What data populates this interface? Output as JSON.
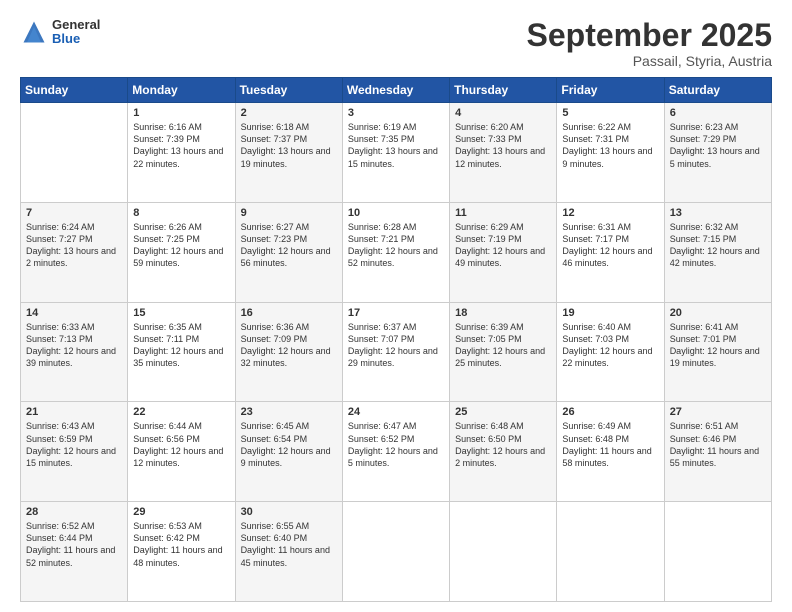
{
  "header": {
    "logo_general": "General",
    "logo_blue": "Blue",
    "month": "September 2025",
    "location": "Passail, Styria, Austria"
  },
  "days_of_week": [
    "Sunday",
    "Monday",
    "Tuesday",
    "Wednesday",
    "Thursday",
    "Friday",
    "Saturday"
  ],
  "weeks": [
    [
      {
        "day": "",
        "sunrise": "",
        "sunset": "",
        "daylight": ""
      },
      {
        "day": "1",
        "sunrise": "Sunrise: 6:16 AM",
        "sunset": "Sunset: 7:39 PM",
        "daylight": "Daylight: 13 hours and 22 minutes."
      },
      {
        "day": "2",
        "sunrise": "Sunrise: 6:18 AM",
        "sunset": "Sunset: 7:37 PM",
        "daylight": "Daylight: 13 hours and 19 minutes."
      },
      {
        "day": "3",
        "sunrise": "Sunrise: 6:19 AM",
        "sunset": "Sunset: 7:35 PM",
        "daylight": "Daylight: 13 hours and 15 minutes."
      },
      {
        "day": "4",
        "sunrise": "Sunrise: 6:20 AM",
        "sunset": "Sunset: 7:33 PM",
        "daylight": "Daylight: 13 hours and 12 minutes."
      },
      {
        "day": "5",
        "sunrise": "Sunrise: 6:22 AM",
        "sunset": "Sunset: 7:31 PM",
        "daylight": "Daylight: 13 hours and 9 minutes."
      },
      {
        "day": "6",
        "sunrise": "Sunrise: 6:23 AM",
        "sunset": "Sunset: 7:29 PM",
        "daylight": "Daylight: 13 hours and 5 minutes."
      }
    ],
    [
      {
        "day": "7",
        "sunrise": "Sunrise: 6:24 AM",
        "sunset": "Sunset: 7:27 PM",
        "daylight": "Daylight: 13 hours and 2 minutes."
      },
      {
        "day": "8",
        "sunrise": "Sunrise: 6:26 AM",
        "sunset": "Sunset: 7:25 PM",
        "daylight": "Daylight: 12 hours and 59 minutes."
      },
      {
        "day": "9",
        "sunrise": "Sunrise: 6:27 AM",
        "sunset": "Sunset: 7:23 PM",
        "daylight": "Daylight: 12 hours and 56 minutes."
      },
      {
        "day": "10",
        "sunrise": "Sunrise: 6:28 AM",
        "sunset": "Sunset: 7:21 PM",
        "daylight": "Daylight: 12 hours and 52 minutes."
      },
      {
        "day": "11",
        "sunrise": "Sunrise: 6:29 AM",
        "sunset": "Sunset: 7:19 PM",
        "daylight": "Daylight: 12 hours and 49 minutes."
      },
      {
        "day": "12",
        "sunrise": "Sunrise: 6:31 AM",
        "sunset": "Sunset: 7:17 PM",
        "daylight": "Daylight: 12 hours and 46 minutes."
      },
      {
        "day": "13",
        "sunrise": "Sunrise: 6:32 AM",
        "sunset": "Sunset: 7:15 PM",
        "daylight": "Daylight: 12 hours and 42 minutes."
      }
    ],
    [
      {
        "day": "14",
        "sunrise": "Sunrise: 6:33 AM",
        "sunset": "Sunset: 7:13 PM",
        "daylight": "Daylight: 12 hours and 39 minutes."
      },
      {
        "day": "15",
        "sunrise": "Sunrise: 6:35 AM",
        "sunset": "Sunset: 7:11 PM",
        "daylight": "Daylight: 12 hours and 35 minutes."
      },
      {
        "day": "16",
        "sunrise": "Sunrise: 6:36 AM",
        "sunset": "Sunset: 7:09 PM",
        "daylight": "Daylight: 12 hours and 32 minutes."
      },
      {
        "day": "17",
        "sunrise": "Sunrise: 6:37 AM",
        "sunset": "Sunset: 7:07 PM",
        "daylight": "Daylight: 12 hours and 29 minutes."
      },
      {
        "day": "18",
        "sunrise": "Sunrise: 6:39 AM",
        "sunset": "Sunset: 7:05 PM",
        "daylight": "Daylight: 12 hours and 25 minutes."
      },
      {
        "day": "19",
        "sunrise": "Sunrise: 6:40 AM",
        "sunset": "Sunset: 7:03 PM",
        "daylight": "Daylight: 12 hours and 22 minutes."
      },
      {
        "day": "20",
        "sunrise": "Sunrise: 6:41 AM",
        "sunset": "Sunset: 7:01 PM",
        "daylight": "Daylight: 12 hours and 19 minutes."
      }
    ],
    [
      {
        "day": "21",
        "sunrise": "Sunrise: 6:43 AM",
        "sunset": "Sunset: 6:59 PM",
        "daylight": "Daylight: 12 hours and 15 minutes."
      },
      {
        "day": "22",
        "sunrise": "Sunrise: 6:44 AM",
        "sunset": "Sunset: 6:56 PM",
        "daylight": "Daylight: 12 hours and 12 minutes."
      },
      {
        "day": "23",
        "sunrise": "Sunrise: 6:45 AM",
        "sunset": "Sunset: 6:54 PM",
        "daylight": "Daylight: 12 hours and 9 minutes."
      },
      {
        "day": "24",
        "sunrise": "Sunrise: 6:47 AM",
        "sunset": "Sunset: 6:52 PM",
        "daylight": "Daylight: 12 hours and 5 minutes."
      },
      {
        "day": "25",
        "sunrise": "Sunrise: 6:48 AM",
        "sunset": "Sunset: 6:50 PM",
        "daylight": "Daylight: 12 hours and 2 minutes."
      },
      {
        "day": "26",
        "sunrise": "Sunrise: 6:49 AM",
        "sunset": "Sunset: 6:48 PM",
        "daylight": "Daylight: 11 hours and 58 minutes."
      },
      {
        "day": "27",
        "sunrise": "Sunrise: 6:51 AM",
        "sunset": "Sunset: 6:46 PM",
        "daylight": "Daylight: 11 hours and 55 minutes."
      }
    ],
    [
      {
        "day": "28",
        "sunrise": "Sunrise: 6:52 AM",
        "sunset": "Sunset: 6:44 PM",
        "daylight": "Daylight: 11 hours and 52 minutes."
      },
      {
        "day": "29",
        "sunrise": "Sunrise: 6:53 AM",
        "sunset": "Sunset: 6:42 PM",
        "daylight": "Daylight: 11 hours and 48 minutes."
      },
      {
        "day": "30",
        "sunrise": "Sunrise: 6:55 AM",
        "sunset": "Sunset: 6:40 PM",
        "daylight": "Daylight: 11 hours and 45 minutes."
      },
      {
        "day": "",
        "sunrise": "",
        "sunset": "",
        "daylight": ""
      },
      {
        "day": "",
        "sunrise": "",
        "sunset": "",
        "daylight": ""
      },
      {
        "day": "",
        "sunrise": "",
        "sunset": "",
        "daylight": ""
      },
      {
        "day": "",
        "sunrise": "",
        "sunset": "",
        "daylight": ""
      }
    ]
  ]
}
